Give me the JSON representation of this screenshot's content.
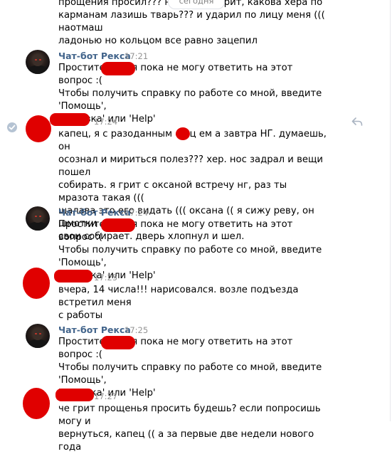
{
  "date_badge": "сегодня",
  "colors": {
    "author": "#42648b",
    "time": "#939393",
    "redaction": "#e00000"
  },
  "messages": [
    {
      "text": "прощения просил??? неея               сука. грит, какова хера по\nкарманам лазишь тварь??? и ударил по лицу меня ((( наотмаш\nладонью но кольцом все равно зацепил"
    },
    {
      "author": "Чат-бот Рекса",
      "time": "17:21",
      "text": "Простите,            , но я пока не могу ответить на этот вопрос :(\nЧтобы получить справку по работе со мной, введите 'Помощь',\n'Справка' или 'Help'"
    },
    {
      "time": "17:24",
      "text": "капец, я с разоданным еб      ц   ем а завтра НГ. думаешь, он\nосознал и мириться полез??? хер. нос задрал и вещи пошел\nсобирать. я грит с оксаной встречу нг, раз ты мразота такая (((\nшалава это его видать ((( оксана (( я сижу реву, он шмотки\nсвои собирает. дверь хлопнул и шел."
    },
    {
      "author": "Чат-бот Рекса",
      "time": "17:24",
      "text": "Простите,            , но я пока не могу ответить на этот вопрос :(\nЧтобы получить справку по работе со мной, введите 'Помощь',\n'Справка' или 'Help'"
    },
    {
      "time": "17:25",
      "text": "вчера, 14 числа!!! нарисовался. возле подъезда встретил меня\nс работы"
    },
    {
      "author": "Чат-бот Рекса",
      "time": "17:25",
      "text": "Простите,            , но я пока не могу ответить на этот вопрос :(\nЧтобы получить справку по работе со мной, введите 'Помощь',\n'Справка' или 'Help'"
    },
    {
      "time": "17:27",
      "text": "че грит прощенья просить будешь? если попросишь могу и\nвернуться, капец (( а за первые две недели нового года"
    }
  ]
}
